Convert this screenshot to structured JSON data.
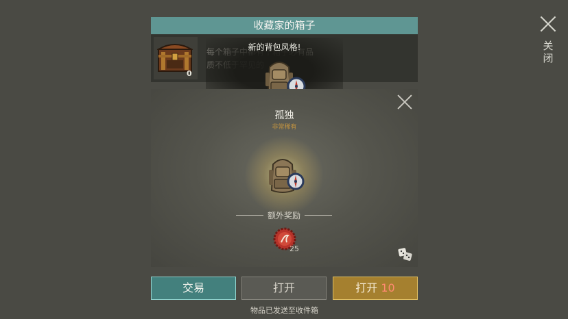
{
  "header": {
    "close_label": "关闭"
  },
  "box": {
    "title": "收藏家的箱子",
    "count": "0",
    "description_line1": "每个箱子中都有个箱子必有品",
    "description_line2": "质不低于罕见的"
  },
  "new_style_banner": "新的背包风格!",
  "reward": {
    "name": "孤独",
    "rarity": "非常稀有",
    "rarity_color": "#c09240",
    "icon": "backpack-icon",
    "badge_icon": "compass-icon"
  },
  "bonus": {
    "label": "额外奖励",
    "icon": "bottle-cap-icon",
    "count": "25"
  },
  "buttons": {
    "trade": "交易",
    "open": "打开",
    "open10_label": "打开",
    "open10_count": "10"
  },
  "status": "物品已发送至收件箱",
  "colors": {
    "title_bar": "#5f9693",
    "trade_button": "#43807d",
    "open10_button": "#a5802f"
  }
}
